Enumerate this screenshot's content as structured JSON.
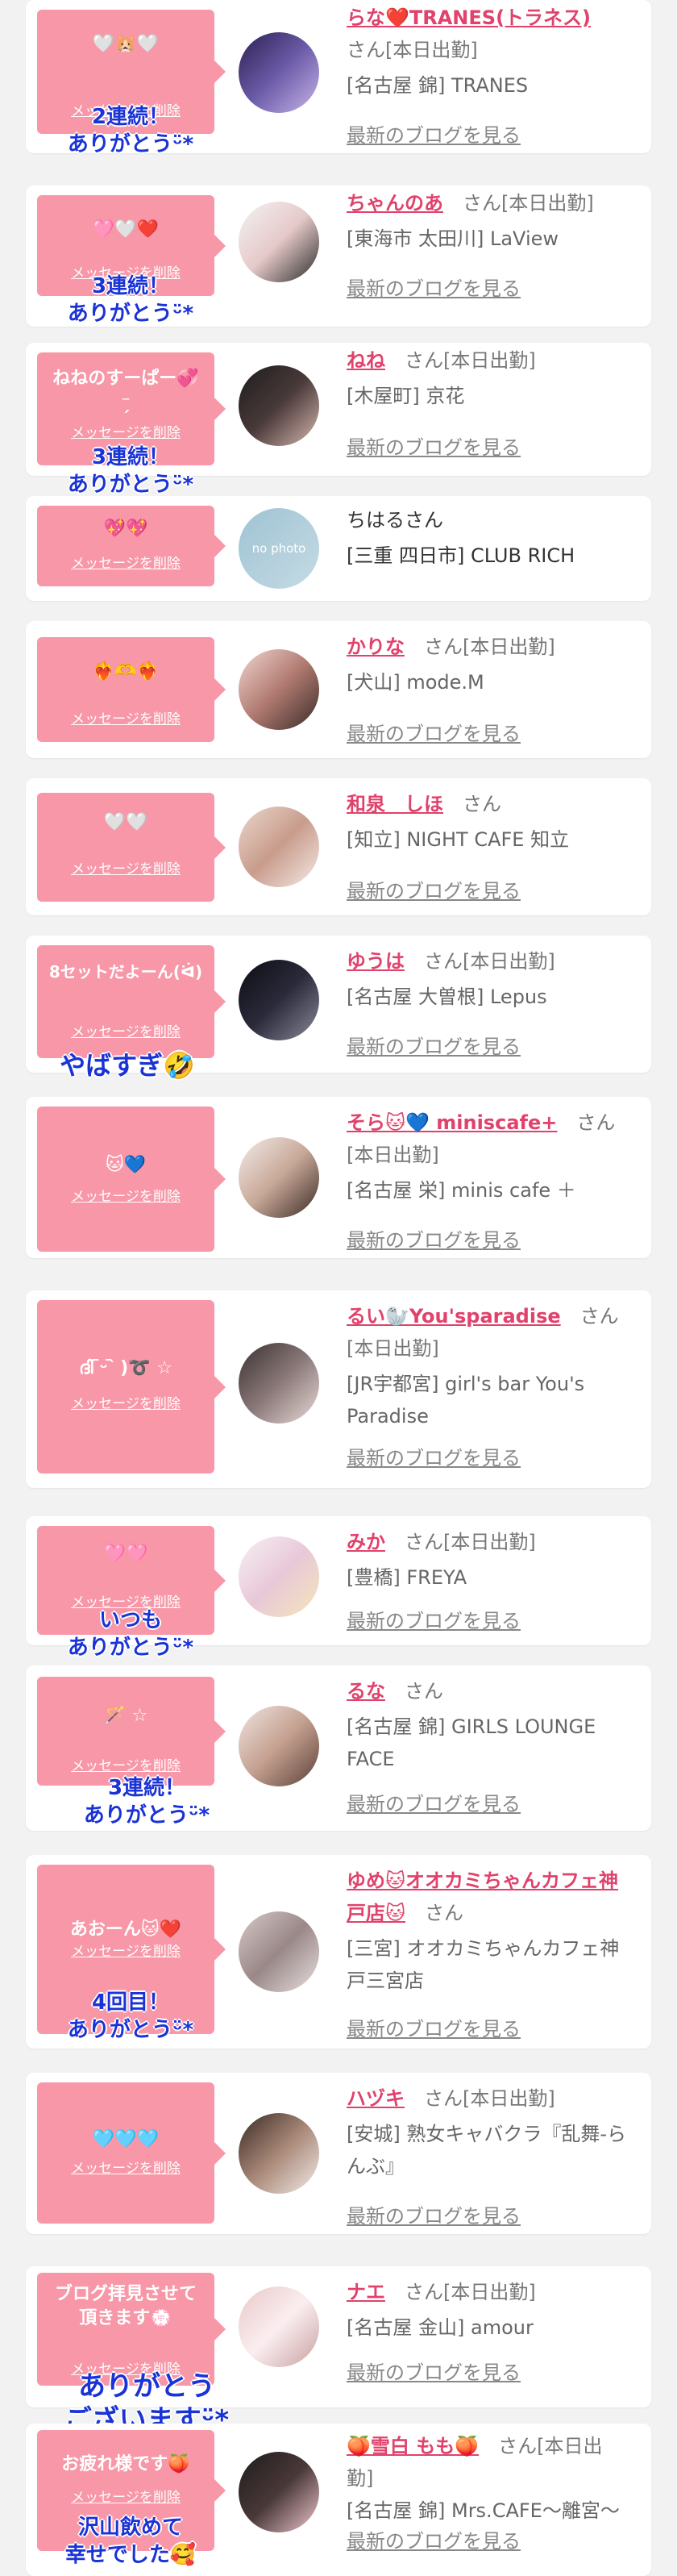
{
  "delete_label": "メッセージを削除",
  "blog_label": "最新のブログを見る",
  "colors": {
    "bubble": "#f797a7",
    "name_link": "#e0426b",
    "thanks_text": "#1a33d6",
    "background": "#f2f2f2"
  },
  "cards": [
    {
      "message": "🤍🐹🤍",
      "thanks": "2連続！\nありがとうᵕ̈*",
      "name": "らな❤️TRANES(トラネス)",
      "suffix": "さん[本日出勤]",
      "shop": "[名古屋 錦] TRANES",
      "avatar_label": "",
      "avatar_bg": "linear-gradient(135deg,#2b2050,#6b5aa8,#c8b6e8)"
    },
    {
      "message": "🩷🤍❤️",
      "thanks": "3連続！\nありがとうᵕ̈*",
      "name": "ちゃんのあ",
      "suffix": "さん[本日出勤]",
      "shop": "[東海市 太田川] LaView",
      "avatar_label": "",
      "avatar_bg": "linear-gradient(135deg,#f3f3f3,#e6c9c9,#2a2a2a)"
    },
    {
      "message": "ねねのすーぱー💞\n⁻̗",
      "thanks": "3連続！\nありがとうᵕ̈*",
      "name": "ねね",
      "suffix": "さん[本日出勤]",
      "shop": "[木屋町] 京花",
      "avatar_label": "",
      "avatar_bg": "linear-gradient(135deg,#1c1c1c,#4a3a3a,#d8b8b0)"
    },
    {
      "message": "💖💖",
      "thanks": "",
      "name": "ちはる",
      "suffix": "さん",
      "shop": "[三重 四日市] CLUB RICH",
      "avatar_label": "no photo",
      "avatar_bg": "linear-gradient(135deg,#9fc3d3,#c5dbe4)"
    },
    {
      "message": "❤️‍🔥🫶❤️‍🔥",
      "thanks": "",
      "name": "かりな",
      "suffix": "さん[本日出勤]",
      "shop": "[犬山] mode.M",
      "avatar_label": "",
      "avatar_bg": "linear-gradient(135deg,#f2d6d2,#b07a70,#3a2a28)"
    },
    {
      "message": "🤍🤍",
      "thanks": "",
      "name": "和泉　しほ",
      "suffix": "さん",
      "shop": "[知立] NIGHT CAFE 知立",
      "avatar_label": "",
      "avatar_bg": "linear-gradient(135deg,#e9d7cc,#c99c8c,#f4ebe6)"
    },
    {
      "message": "8セットだよーん(ᐛ)",
      "thanks": "やばすぎ🤣",
      "name": "ゆうは",
      "suffix": "さん[本日出勤]",
      "shop": "[名古屋 大曽根] Lepus",
      "avatar_label": "",
      "avatar_bg": "linear-gradient(135deg,#0c0c14,#2a2a3a,#8a8a9a)"
    },
    {
      "message": "🐱💙",
      "thanks": "",
      "name": "そら🐱💙 miniscafe+",
      "suffix": "さん[本日出勤]",
      "shop": "[名古屋 栄] minis cafe ＋",
      "avatar_label": "",
      "avatar_bg": "linear-gradient(135deg,#f4ecea,#c8a898,#3a2a24)"
    },
    {
      "message": "ദി ᷇ᵕ ᷆ )➰ ☆",
      "thanks": "",
      "name": "るい🦭You'sparadise",
      "suffix": "さん[本日出勤]",
      "shop": "[JR宇都宮] girl's bar You's Paradise",
      "avatar_label": "",
      "avatar_bg": "linear-gradient(135deg,#3a3030,#8a7878,#e8dcd8)"
    },
    {
      "message": "🩷🩷",
      "thanks": "いつも\nありがとうᵕ̈*",
      "name": "みか",
      "suffix": "さん[本日出勤]",
      "shop": "[豊橋] FREYA",
      "avatar_label": "",
      "avatar_bg": "linear-gradient(135deg,#f7f0f4,#e8c8d8,#f4e6b8)"
    },
    {
      "message": "🪄 ☆",
      "thanks": "3連続！\nありがとうᵕ̈*",
      "name": "るな",
      "suffix": "さん",
      "shop": "[名古屋 錦] GIRLS LOUNGE FACE",
      "avatar_label": "",
      "avatar_bg": "linear-gradient(135deg,#f0e4e0,#c4a090,#5a4038)"
    },
    {
      "message": "あおーん🐱❤️",
      "thanks": "4回目！\nありがとうᵕ̈*",
      "name": "ゆめ🐱オオカミちゃんカフェ神戸店🐱",
      "suffix": "さん",
      "shop": "[三宮] オオカミちゃんカフェ神戸三宮店",
      "avatar_label": "",
      "avatar_bg": "linear-gradient(135deg,#d8c8c8,#9a8888,#e8e0e0)"
    },
    {
      "message": "🩵🩵🩵",
      "thanks": "",
      "name": "ハヅキ",
      "suffix": "さん[本日出勤]",
      "shop": "[安城] 熟女キャバクラ『乱舞-らんぶ』",
      "avatar_label": "",
      "avatar_bg": "linear-gradient(135deg,#3a2a24,#a88878,#f4ece8)"
    },
    {
      "message": "ブログ拝見させて\n頂きます💮",
      "thanks": "ありがとう\nございますᵕ̈*",
      "name": "ナエ",
      "suffix": "さん[本日出勤]",
      "shop": "[名古屋 金山] amour",
      "avatar_label": "",
      "avatar_bg": "linear-gradient(135deg,#e8c8c8,#fbeef0,#c8a0a0)"
    },
    {
      "message": "お疲れ様です🍑",
      "thanks": "沢山飲めて\n幸せでした🥰",
      "name": "🍑雪白 もも🍑",
      "suffix": "さん[本日出勤]",
      "shop": "[名古屋 錦] Mrs.CAFE〜離宮〜",
      "avatar_label": "",
      "avatar_bg": "linear-gradient(135deg,#1c1c1c,#4a3838,#f0c8d0)"
    }
  ]
}
